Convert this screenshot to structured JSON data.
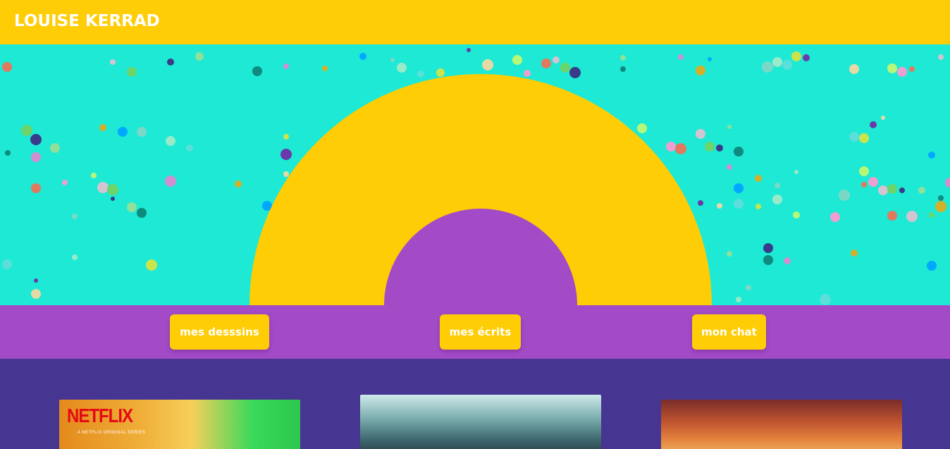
{
  "header": {
    "title": "LOUISE KERRAD"
  },
  "nav": {
    "buttons": [
      {
        "label": "mes desssins"
      },
      {
        "label": "mes écrits"
      },
      {
        "label": "mon chat"
      }
    ]
  },
  "cards": [
    {
      "brand_logo": "NETFLIX",
      "caption": "A NETFLIX ORIGINAL SERIES",
      "image": "series-poster-image"
    },
    {
      "image": "movie-poster-image"
    },
    {
      "image": "anime-poster-image"
    }
  ],
  "colors": {
    "yellow": "#fecd05",
    "turquoise": "#1de9d4",
    "purple": "#a34bc7",
    "indigo": "#473592"
  }
}
